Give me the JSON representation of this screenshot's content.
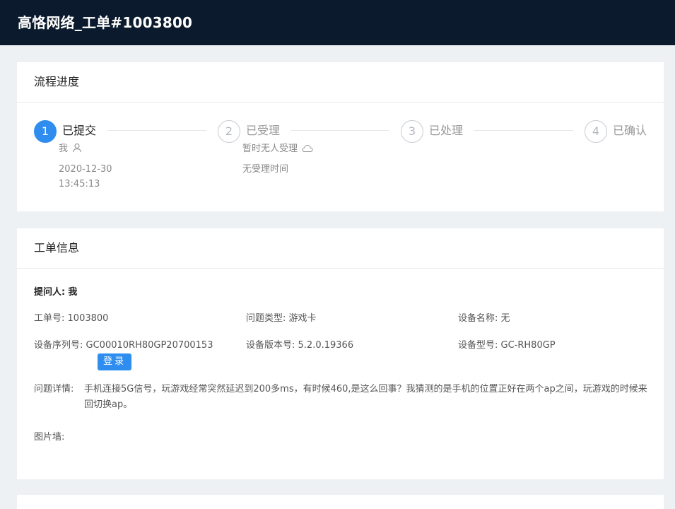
{
  "header": {
    "title": "高恪网络_工单#1003800"
  },
  "progress": {
    "title": "流程进度",
    "steps": [
      {
        "num": "1",
        "label": "已提交",
        "person": "我",
        "time_line1": "2020-12-30",
        "time_line2": "13:45:13"
      },
      {
        "num": "2",
        "label": "已受理",
        "person": "暂时无人受理",
        "time_line1": "无受理时间"
      },
      {
        "num": "3",
        "label": "已处理"
      },
      {
        "num": "4",
        "label": "已确认"
      }
    ]
  },
  "ticket": {
    "title": "工单信息",
    "submitter_label": "提问人:",
    "submitter_value": "我",
    "ticket_no_label": "工单号:",
    "ticket_no_value": "1003800",
    "issue_type_label": "问题类型:",
    "issue_type_value": "游戏卡",
    "device_name_label": "设备名称:",
    "device_name_value": "无",
    "serial_label": "设备序列号:",
    "serial_value": "GC00010RH80GP20700153",
    "version_label": "设备版本号:",
    "version_value": "5.2.0.19366",
    "model_label": "设备型号:",
    "model_value": "GC-RH80GP",
    "login_button": "登录",
    "detail_label": "问题详情:",
    "detail_value": "手机连接5G信号，玩游戏经常突然延迟到200多ms，有时候460,是这么回事？我猜测的是手机的位置正好在两个ap之间，玩游戏的时候来回切换ap。",
    "images_label": "图片墙:"
  },
  "colors": {
    "topbar": "#0b1b2d",
    "accent": "#2f8df0",
    "background": "#eef1f4"
  },
  "icons": {
    "person": "user-icon",
    "cloud": "cloud-icon"
  }
}
